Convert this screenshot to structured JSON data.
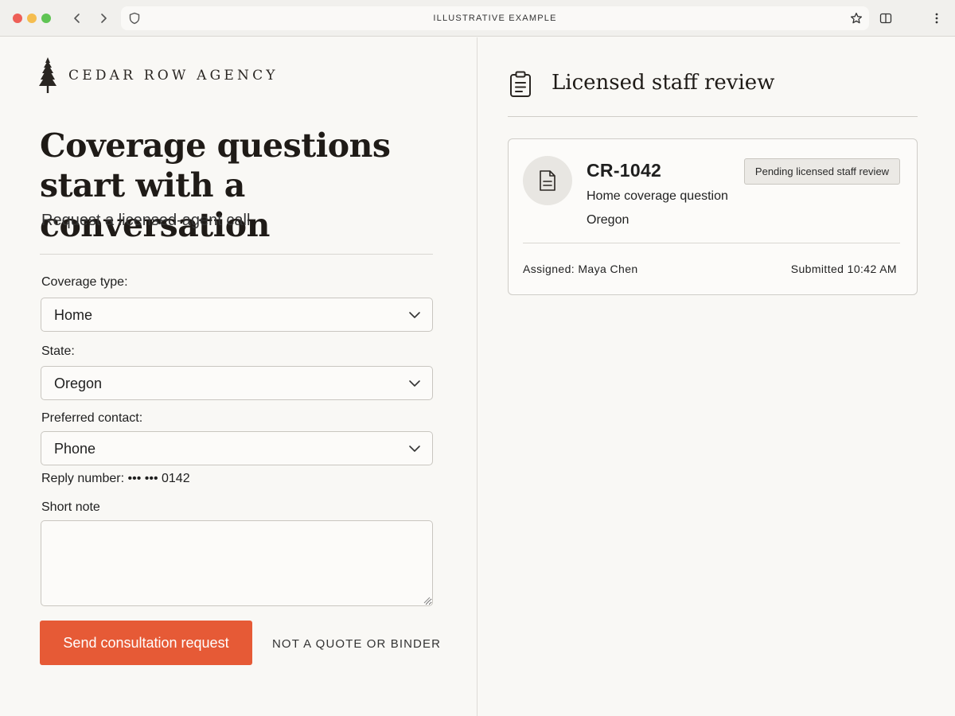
{
  "browser": {
    "address_text": "ILLUSTRATIVE EXAMPLE",
    "icons": {
      "back": "chevron-left-icon",
      "forward": "chevron-right-icon",
      "site": "shield-icon",
      "bookmark": "star-icon",
      "sidebar": "split-view-icon",
      "menu": "kebab-menu-icon"
    }
  },
  "brand": {
    "name": "CEDAR ROW AGENCY",
    "logo_icon": "pine-tree-icon"
  },
  "form": {
    "headline_line1": "Coverage questions",
    "headline_line2": "start with a conversation",
    "subline": "Request a licensed-agent call",
    "coverage_label": "Coverage type:",
    "coverage_value": "Home",
    "state_label": "State:",
    "state_value": "Oregon",
    "contact_label": "Preferred contact:",
    "contact_value": "Phone",
    "reply_number": "Reply number: ••• ••• 0142",
    "note_label": "Short note",
    "note_value": "",
    "submit_label": "Send consultation request",
    "disclaimer": "NOT A QUOTE OR BINDER"
  },
  "review": {
    "title": "Licensed staff review",
    "header_icon": "clipboard-icon",
    "card": {
      "icon": "document-icon",
      "id": "CR-1042",
      "subject": "Home coverage question",
      "state": "Oregon",
      "status": "Pending licensed staff review",
      "assigned": "Assigned: Maya Chen",
      "submitted": "Submitted 10:42 AM"
    }
  },
  "colors": {
    "accent": "#e65a36",
    "background": "#f9f8f5",
    "text": "#1f1b17"
  }
}
